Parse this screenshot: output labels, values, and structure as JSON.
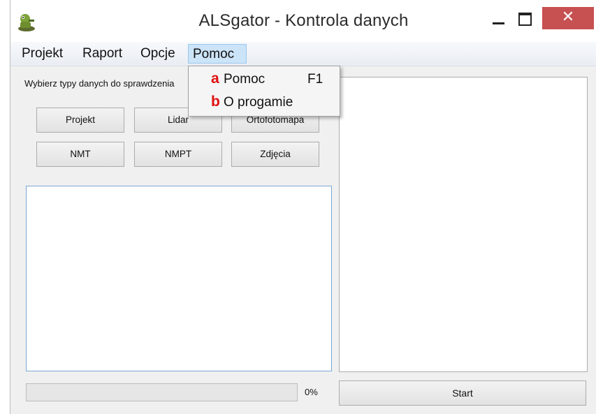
{
  "window": {
    "title": "ALSgator - Kontrola danych",
    "close_glyph": "✕"
  },
  "menubar": {
    "items": [
      {
        "label": "Projekt"
      },
      {
        "label": "Raport"
      },
      {
        "label": "Opcje"
      },
      {
        "label": "Pomoc",
        "active": true
      }
    ]
  },
  "dropdown": {
    "items": [
      {
        "badge": "a",
        "label": "Pomoc",
        "shortcut": "F1"
      },
      {
        "badge": "b",
        "label": "O progamie",
        "shortcut": ""
      }
    ]
  },
  "left_panel": {
    "instruction": "Wybierz typy danych do sprawdzenia",
    "buttons": [
      "Projekt",
      "Lidar",
      "Ortofotomapa",
      "NMT",
      "NMPT",
      "Zdjęcia"
    ],
    "progress_value": 0,
    "progress_label": "0%"
  },
  "right_panel": {
    "start_label": "Start"
  },
  "colors": {
    "close": "#c75050",
    "menu_active": "#cce4f7",
    "badge": "#e01010",
    "list_border": "#7aa7d6"
  }
}
